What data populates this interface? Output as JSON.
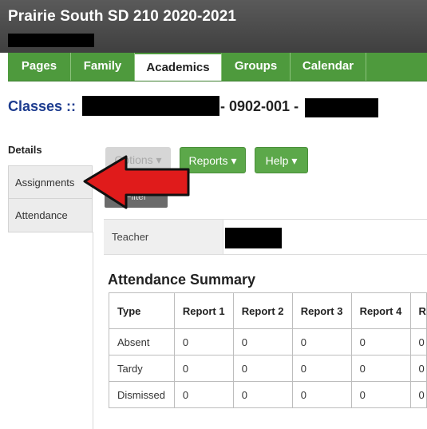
{
  "header": {
    "school": "Prairie South SD 210 2020-2021"
  },
  "tabs": [
    {
      "label": "Pages"
    },
    {
      "label": "Family"
    },
    {
      "label": "Academics"
    },
    {
      "label": "Groups"
    },
    {
      "label": "Calendar"
    }
  ],
  "breadcrumb": {
    "prefix": "Classes ::",
    "section": "- 0902-001 -"
  },
  "sidebar": {
    "heading": "Details",
    "items": [
      {
        "label": "Assignments"
      },
      {
        "label": "Attendance"
      }
    ]
  },
  "toolbar": {
    "options_label": "Options ▾",
    "reports_label": "Reports ▾",
    "help_label": "Help ▾",
    "filter_label": "Filter"
  },
  "teacher": {
    "label": "Teacher"
  },
  "attendance": {
    "title": "Attendance Summary",
    "columns": [
      "Type",
      "Report 1",
      "Report 2",
      "Report 3",
      "Report 4",
      "R"
    ],
    "rows": [
      {
        "type": "Absent",
        "values": [
          "0",
          "0",
          "0",
          "0",
          "0"
        ]
      },
      {
        "type": "Tardy",
        "values": [
          "0",
          "0",
          "0",
          "0",
          "0"
        ]
      },
      {
        "type": "Dismissed",
        "values": [
          "0",
          "0",
          "0",
          "0",
          "0"
        ]
      }
    ]
  },
  "colors": {
    "header_bg": "#484848",
    "tab_green": "#4e9a3d",
    "link_blue": "#1d3c8f",
    "annotation_arrow": "#e01b1b"
  },
  "annotation": {
    "shape": "red-arrow-icon",
    "points_to": "Assignments"
  }
}
